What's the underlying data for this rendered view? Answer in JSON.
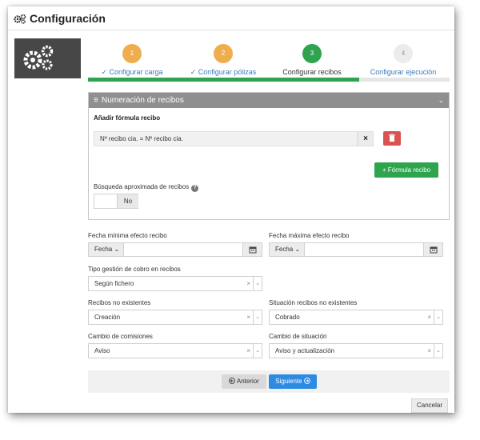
{
  "header": {
    "title": "Configuración",
    "icon": "gears-icon"
  },
  "steps": [
    {
      "number": "1",
      "label": "Configurar carga",
      "check": "✓",
      "status": "done"
    },
    {
      "number": "2",
      "label": "Configurar pólizas",
      "check": "✓",
      "status": "done"
    },
    {
      "number": "3",
      "label": "Configurar recibos",
      "check": "",
      "status": "current"
    },
    {
      "number": "4",
      "label": "Configurar ejecución",
      "check": "",
      "status": "todo"
    }
  ],
  "progress": 0.75,
  "panel": {
    "title": "Numeración de recibos",
    "formula_title": "Añadir fórmula recibo",
    "formula_value": "Nº recibo cia. = Nº recibo cia.",
    "clear_glyph": "×",
    "add_button": "+ Fórmula recibo",
    "approx_label": "Búsqueda aproximada de recibos",
    "help_glyph": "?",
    "toggle_value": "No"
  },
  "fields": {
    "fecha_min_label": "Fecha mínima efecto recibo",
    "fecha_max_label": "Fecha máxima efecto recibo",
    "fecha_prefix": "Fecha",
    "tipo_gestion_label": "Tipo gestión de cobro en recibos",
    "tipo_gestion_value": "Según fichero",
    "no_existentes_label": "Recibos no existentes",
    "no_existentes_value": "Creación",
    "situacion_label": "Situación recibos no existentes",
    "situacion_value": "Cobrado",
    "comisiones_label": "Cambio de comisiones",
    "comisiones_value": "Aviso",
    "cambio_situacion_label": "Cambio de situación",
    "cambio_situacion_value": "Aviso y actualización",
    "clear_glyph": "×",
    "dropdown_glyph": "⌄"
  },
  "footer": {
    "prev": "Anterior",
    "next": "Siguiente",
    "cancel": "Cancelar"
  },
  "colors": {
    "done": "#f0ad4e",
    "current": "#2ea44f",
    "primary": "#2e8be3",
    "danger": "#d9534f",
    "link": "#3a7cb8"
  }
}
